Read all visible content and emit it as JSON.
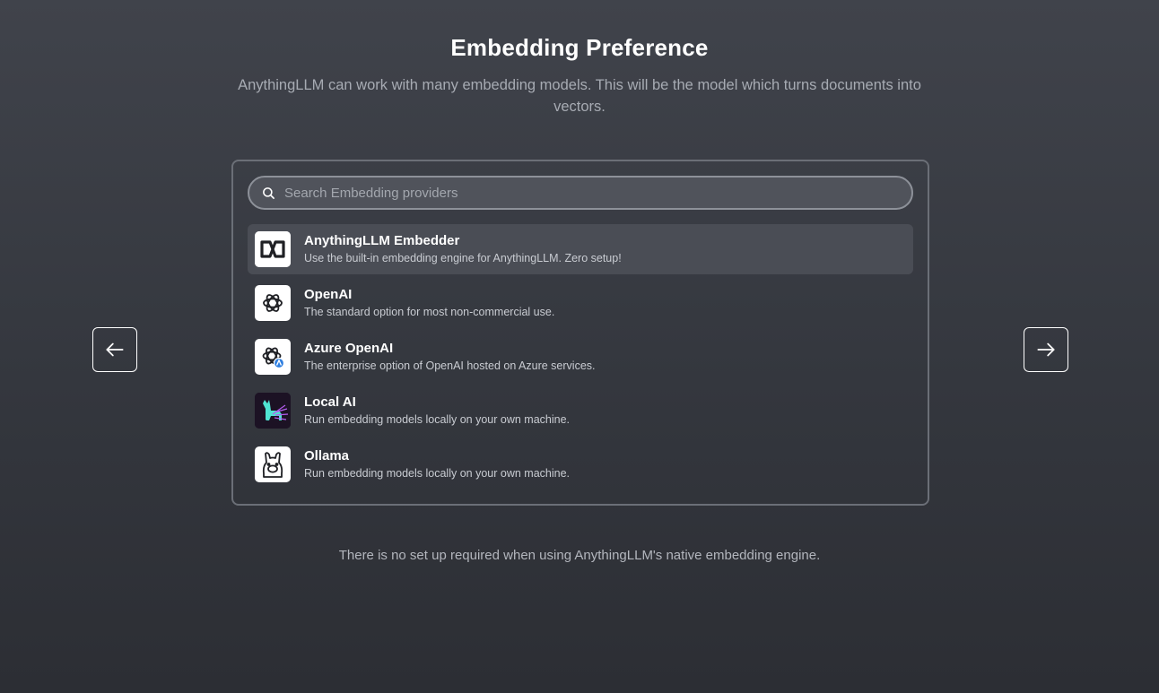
{
  "header": {
    "title": "Embedding Preference",
    "subtitle": "AnythingLLM can work with many embedding models. This will be the model which turns documents into vectors."
  },
  "navigation": {
    "back_icon": "arrow-left-icon",
    "next_icon": "arrow-right-icon"
  },
  "search": {
    "placeholder": "Search Embedding providers",
    "value": "",
    "icon": "search-icon"
  },
  "providers": [
    {
      "name": "AnythingLLM Embedder",
      "description": "Use the built-in embedding engine for AnythingLLM. Zero setup!",
      "icon": "anythingllm-logo-icon",
      "selected": true
    },
    {
      "name": "OpenAI",
      "description": "The standard option for most non-commercial use.",
      "icon": "openai-logo-icon",
      "selected": false
    },
    {
      "name": "Azure OpenAI",
      "description": "The enterprise option of OpenAI hosted on Azure services.",
      "icon": "azure-openai-logo-icon",
      "selected": false
    },
    {
      "name": "Local AI",
      "description": "Run embedding models locally on your own machine.",
      "icon": "localai-llama-logo-icon",
      "selected": false
    },
    {
      "name": "Ollama",
      "description": "Run embedding models locally on your own machine.",
      "icon": "ollama-llama-logo-icon",
      "selected": false
    }
  ],
  "footer": {
    "note": "There is no set up required when using AnythingLLM's native embedding engine."
  },
  "colors": {
    "background": "#3a3d44",
    "selected_row": "#4a4d55",
    "panel_border": "#6b6f77",
    "text_primary": "#ffffff",
    "text_secondary": "#a7abb3"
  }
}
